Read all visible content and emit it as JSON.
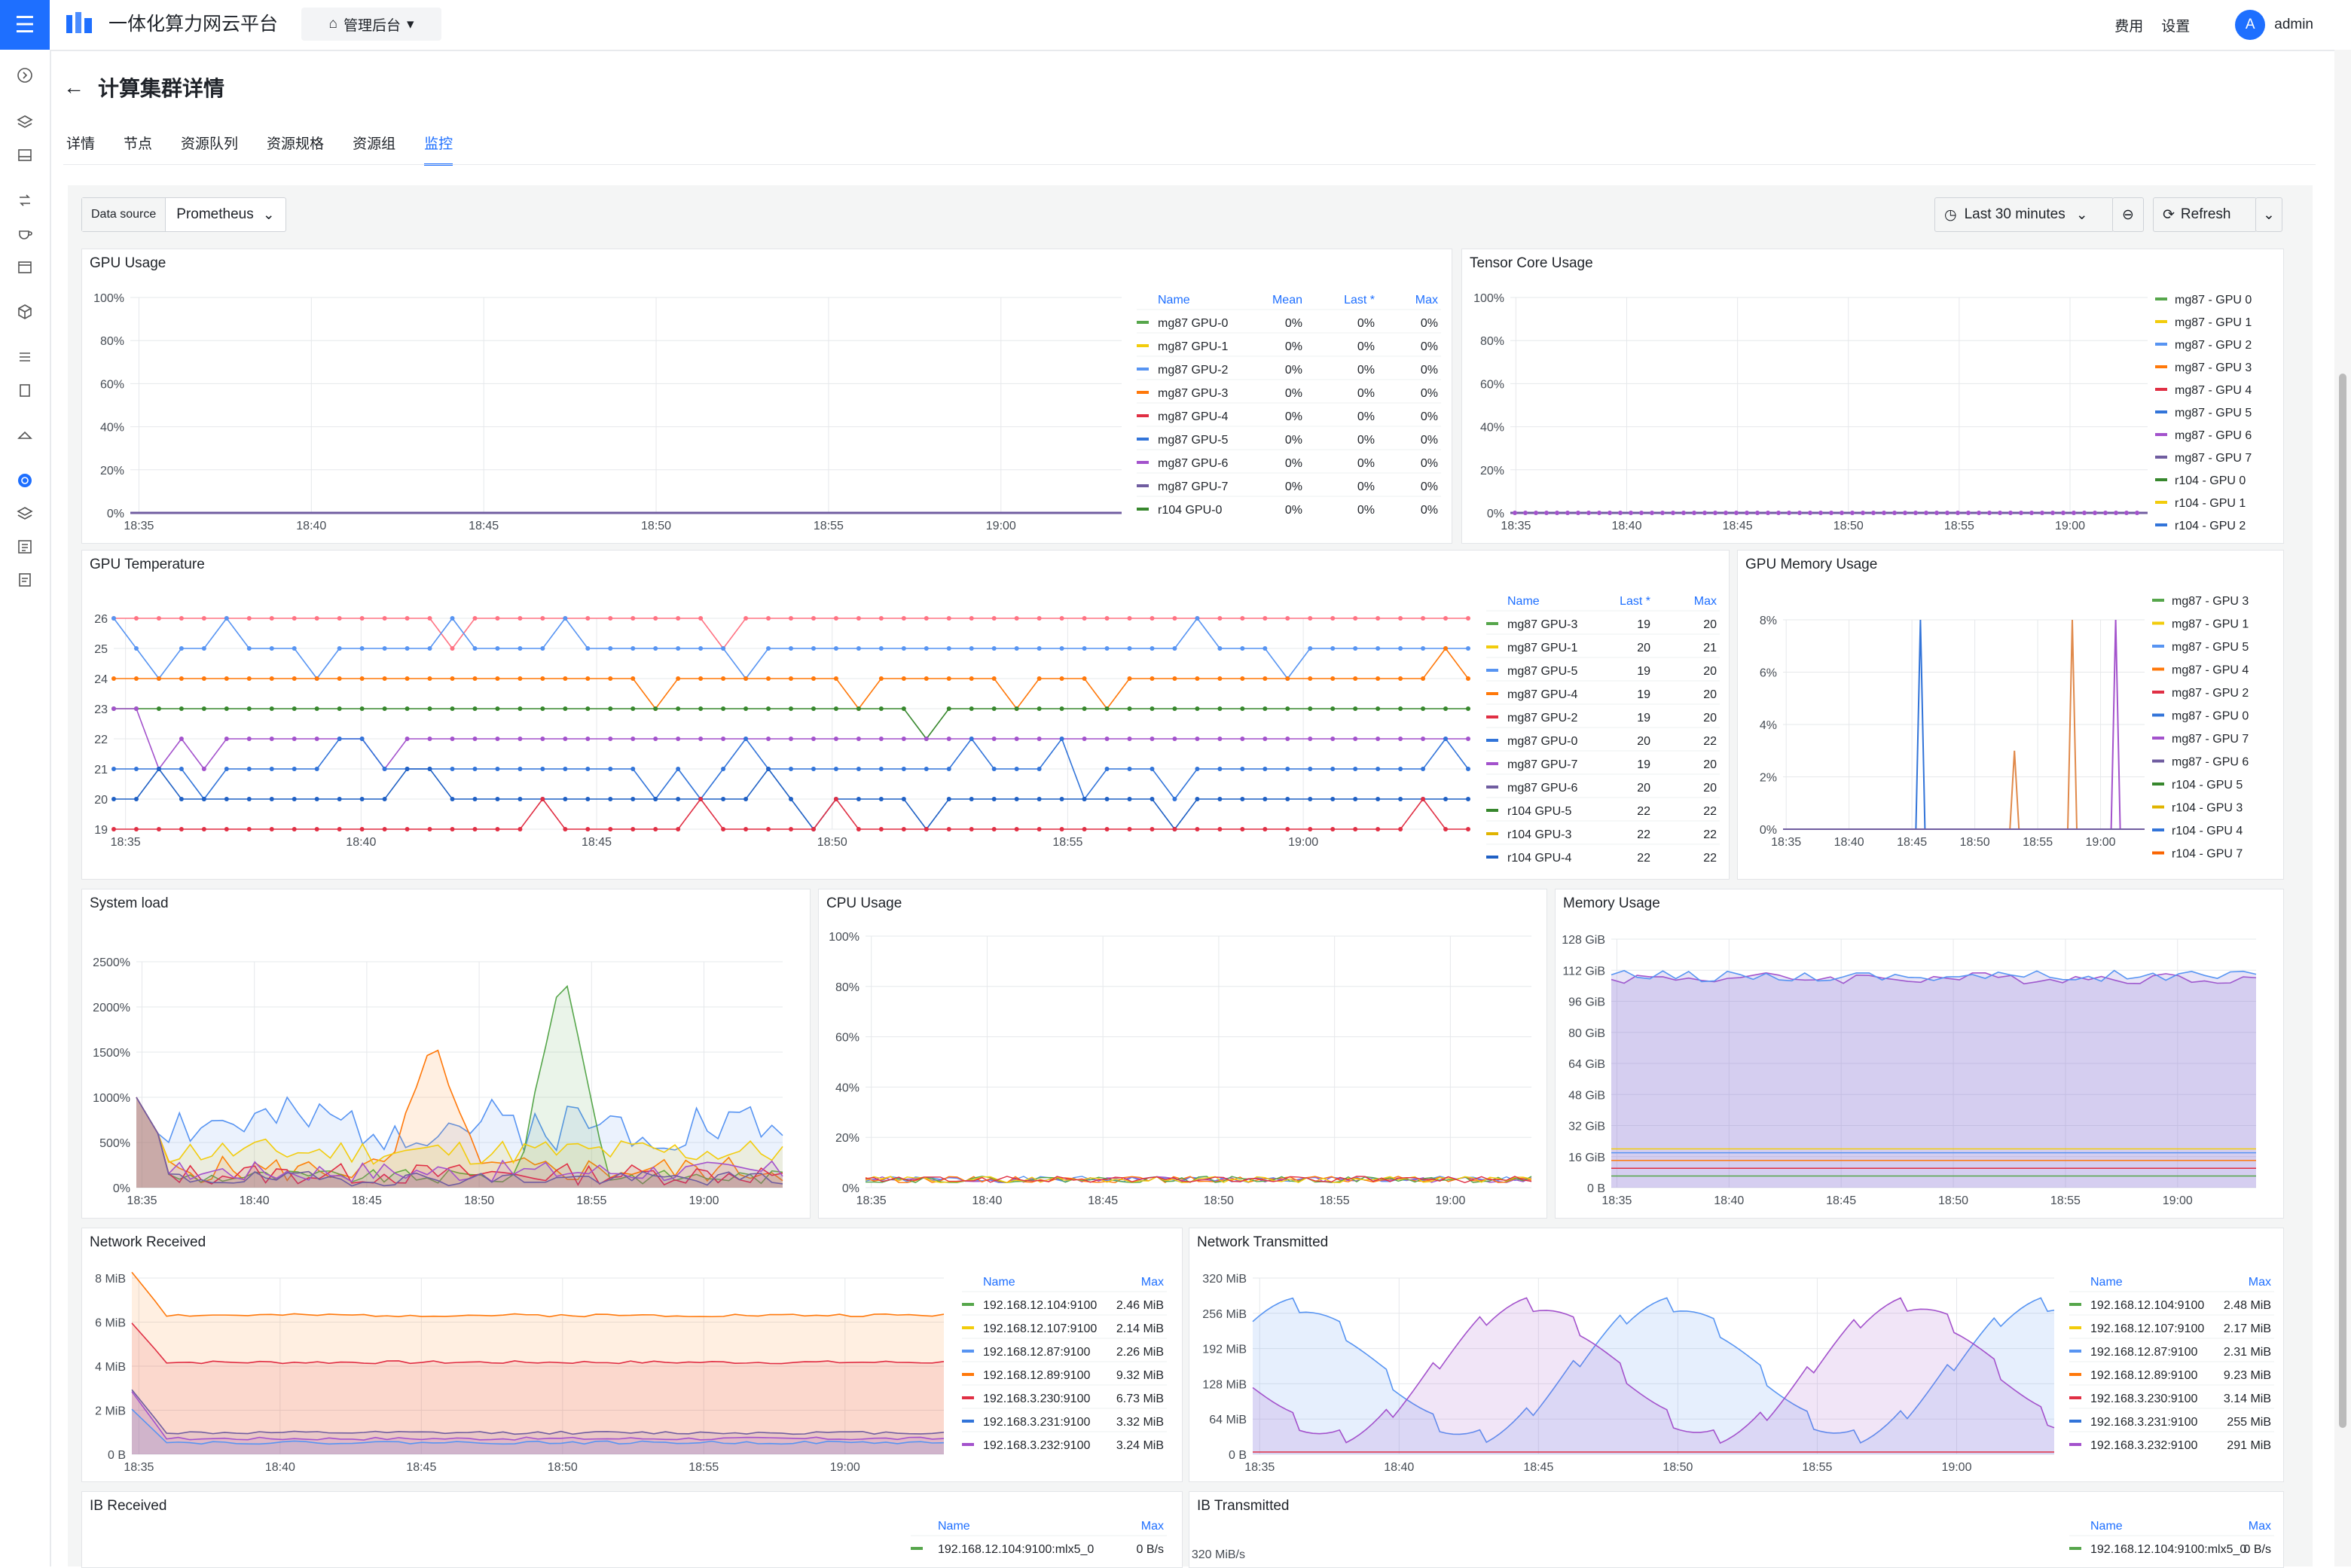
{
  "app_title": "一体化算力网云平台",
  "admin_menu": "管理后台",
  "header_links": [
    "费用",
    "设置"
  ],
  "user": {
    "initial": "A",
    "name": "admin"
  },
  "page_title": "计算集群详情",
  "tabs": [
    "详情",
    "节点",
    "资源队列",
    "资源规格",
    "资源组",
    "监控"
  ],
  "active_tab": "监控",
  "toolbar": {
    "ds_label": "Data source",
    "ds_value": "Prometheus",
    "time_range": "Last 30 minutes",
    "refresh": "Refresh"
  },
  "time_ticks": [
    "18:35",
    "18:40",
    "18:45",
    "18:50",
    "18:55",
    "19:00"
  ],
  "gpu_usage": {
    "title": "GPU Usage",
    "y_ticks": [
      "0%",
      "20%",
      "40%",
      "60%",
      "80%",
      "100%"
    ],
    "legend_headers": [
      "Name",
      "Mean",
      "Last *",
      "Max"
    ],
    "rows": [
      {
        "name": "mg87 GPU-0",
        "mean": "0%",
        "last": "0%",
        "max": "0%",
        "color": "#56a64b"
      },
      {
        "name": "mg87 GPU-1",
        "mean": "0%",
        "last": "0%",
        "max": "0%",
        "color": "#f2cc0c"
      },
      {
        "name": "mg87 GPU-2",
        "mean": "0%",
        "last": "0%",
        "max": "0%",
        "color": "#5794f2"
      },
      {
        "name": "mg87 GPU-3",
        "mean": "0%",
        "last": "0%",
        "max": "0%",
        "color": "#ff780a"
      },
      {
        "name": "mg87 GPU-4",
        "mean": "0%",
        "last": "0%",
        "max": "0%",
        "color": "#e02f44"
      },
      {
        "name": "mg87 GPU-5",
        "mean": "0%",
        "last": "0%",
        "max": "0%",
        "color": "#3274d9"
      },
      {
        "name": "mg87 GPU-6",
        "mean": "0%",
        "last": "0%",
        "max": "0%",
        "color": "#a352cc"
      },
      {
        "name": "mg87 GPU-7",
        "mean": "0%",
        "last": "0%",
        "max": "0%",
        "color": "#705da0"
      },
      {
        "name": "r104 GPU-0",
        "mean": "0%",
        "last": "0%",
        "max": "0%",
        "color": "#37872d"
      }
    ]
  },
  "tensor_core": {
    "title": "Tensor Core Usage",
    "y_ticks": [
      "0%",
      "20%",
      "40%",
      "60%",
      "80%",
      "100%"
    ],
    "legend": [
      {
        "name": "mg87 - GPU 0",
        "color": "#56a64b"
      },
      {
        "name": "mg87 - GPU 1",
        "color": "#f2cc0c"
      },
      {
        "name": "mg87 - GPU 2",
        "color": "#5794f2"
      },
      {
        "name": "mg87 - GPU 3",
        "color": "#ff780a"
      },
      {
        "name": "mg87 - GPU 4",
        "color": "#e02f44"
      },
      {
        "name": "mg87 - GPU 5",
        "color": "#3274d9"
      },
      {
        "name": "mg87 - GPU 6",
        "color": "#a352cc"
      },
      {
        "name": "mg87 - GPU 7",
        "color": "#705da0"
      },
      {
        "name": "r104 - GPU 0",
        "color": "#37872d"
      },
      {
        "name": "r104 - GPU 1",
        "color": "#f2cc0c"
      },
      {
        "name": "r104 - GPU 2",
        "color": "#3274d9"
      }
    ]
  },
  "gpu_temp": {
    "title": "GPU Temperature",
    "y_ticks": [
      "19",
      "20",
      "21",
      "22",
      "23",
      "24",
      "25",
      "26"
    ],
    "legend_headers": [
      "Name",
      "Last *",
      "Max"
    ],
    "rows": [
      {
        "name": "mg87 GPU-3",
        "last": "19",
        "max": "20",
        "color": "#56a64b"
      },
      {
        "name": "mg87 GPU-1",
        "last": "20",
        "max": "21",
        "color": "#f2cc0c"
      },
      {
        "name": "mg87 GPU-5",
        "last": "19",
        "max": "20",
        "color": "#5794f2"
      },
      {
        "name": "mg87 GPU-4",
        "last": "19",
        "max": "20",
        "color": "#ff780a"
      },
      {
        "name": "mg87 GPU-2",
        "last": "19",
        "max": "20",
        "color": "#e02f44"
      },
      {
        "name": "mg87 GPU-0",
        "last": "20",
        "max": "22",
        "color": "#3274d9"
      },
      {
        "name": "mg87 GPU-7",
        "last": "19",
        "max": "20",
        "color": "#a352cc"
      },
      {
        "name": "mg87 GPU-6",
        "last": "20",
        "max": "20",
        "color": "#705da0"
      },
      {
        "name": "r104 GPU-5",
        "last": "22",
        "max": "22",
        "color": "#37872d"
      },
      {
        "name": "r104 GPU-3",
        "last": "22",
        "max": "22",
        "color": "#e0b400"
      },
      {
        "name": "r104 GPU-4",
        "last": "22",
        "max": "22",
        "color": "#1f60c4"
      }
    ]
  },
  "gpu_mem": {
    "title": "GPU Memory Usage",
    "y_ticks": [
      "0%",
      "2%",
      "4%",
      "6%",
      "8%"
    ],
    "x_ticks": [
      "18:35",
      "18:40",
      "18:45",
      "18:50",
      "18:55",
      "19:00"
    ],
    "legend": [
      {
        "name": "mg87 - GPU 3",
        "color": "#56a64b"
      },
      {
        "name": "mg87 - GPU 1",
        "color": "#f2cc0c"
      },
      {
        "name": "mg87 - GPU 5",
        "color": "#5794f2"
      },
      {
        "name": "mg87 - GPU 4",
        "color": "#ff780a"
      },
      {
        "name": "mg87 - GPU 2",
        "color": "#e02f44"
      },
      {
        "name": "mg87 - GPU 0",
        "color": "#3274d9"
      },
      {
        "name": "mg87 - GPU 7",
        "color": "#a352cc"
      },
      {
        "name": "mg87 - GPU 6",
        "color": "#705da0"
      },
      {
        "name": "r104 - GPU 5",
        "color": "#37872d"
      },
      {
        "name": "r104 - GPU 3",
        "color": "#e0b400"
      },
      {
        "name": "r104 - GPU 4",
        "color": "#3274d9"
      },
      {
        "name": "r104 - GPU 7",
        "color": "#fa6400"
      }
    ]
  },
  "system_load": {
    "title": "System load",
    "y_ticks": [
      "0%",
      "500%",
      "1000%",
      "1500%",
      "2000%",
      "2500%"
    ]
  },
  "cpu_usage": {
    "title": "CPU Usage",
    "y_ticks": [
      "0%",
      "20%",
      "40%",
      "60%",
      "80%",
      "100%"
    ]
  },
  "memory_usage": {
    "title": "Memory Usage",
    "y_ticks": [
      "0 B",
      "16 GiB",
      "32 GiB",
      "48 GiB",
      "64 GiB",
      "80 GiB",
      "96 GiB",
      "112 GiB",
      "128 GiB"
    ]
  },
  "net_rx": {
    "title": "Network Received",
    "y_ticks": [
      "0 B",
      "2 MiB",
      "4 MiB",
      "6 MiB",
      "8 MiB"
    ],
    "legend_headers": [
      "Name",
      "Max"
    ],
    "rows": [
      {
        "name": "192.168.12.104:9100",
        "max": "2.46 MiB",
        "color": "#56a64b"
      },
      {
        "name": "192.168.12.107:9100",
        "max": "2.14 MiB",
        "color": "#f2cc0c"
      },
      {
        "name": "192.168.12.87:9100",
        "max": "2.26 MiB",
        "color": "#5794f2"
      },
      {
        "name": "192.168.12.89:9100",
        "max": "9.32 MiB",
        "color": "#ff780a"
      },
      {
        "name": "192.168.3.230:9100",
        "max": "6.73 MiB",
        "color": "#e02f44"
      },
      {
        "name": "192.168.3.231:9100",
        "max": "3.32 MiB",
        "color": "#3274d9"
      },
      {
        "name": "192.168.3.232:9100",
        "max": "3.24 MiB",
        "color": "#a352cc"
      }
    ]
  },
  "net_tx": {
    "title": "Network Transmitted",
    "y_ticks": [
      "0 B",
      "64 MiB",
      "128 MiB",
      "192 MiB",
      "256 MiB",
      "320 MiB"
    ],
    "legend_headers": [
      "Name",
      "Max"
    ],
    "rows": [
      {
        "name": "192.168.12.104:9100",
        "max": "2.48 MiB",
        "color": "#56a64b"
      },
      {
        "name": "192.168.12.107:9100",
        "max": "2.17 MiB",
        "color": "#f2cc0c"
      },
      {
        "name": "192.168.12.87:9100",
        "max": "2.31 MiB",
        "color": "#5794f2"
      },
      {
        "name": "192.168.12.89:9100",
        "max": "9.23 MiB",
        "color": "#ff780a"
      },
      {
        "name": "192.168.3.230:9100",
        "max": "3.14 MiB",
        "color": "#e02f44"
      },
      {
        "name": "192.168.3.231:9100",
        "max": "255 MiB",
        "color": "#3274d9"
      },
      {
        "name": "192.168.3.232:9100",
        "max": "291 MiB",
        "color": "#a352cc"
      }
    ]
  },
  "ib_rx": {
    "title": "IB Received",
    "legend_headers": [
      "Name",
      "Max"
    ],
    "rows": [
      {
        "name": "192.168.12.104:9100:mlx5_0",
        "max": "0 B/s",
        "color": "#56a64b"
      }
    ]
  },
  "ib_tx": {
    "title": "IB Transmitted",
    "y_top": "320 MiB/s",
    "legend_headers": [
      "Name",
      "Max"
    ],
    "rows": [
      {
        "name": "192.168.12.104:9100:mlx5_0",
        "max": "0 B/s",
        "color": "#56a64b"
      }
    ]
  },
  "chart_data": [
    {
      "type": "line",
      "title": "GPU Usage",
      "ylim": [
        0,
        100
      ],
      "series_values": "all 0%"
    },
    {
      "type": "line",
      "title": "Tensor Core Usage",
      "ylim": [
        0,
        100
      ],
      "series_values": "all 0%"
    },
    {
      "type": "line",
      "title": "GPU Temperature",
      "ylim": [
        19,
        26
      ]
    },
    {
      "type": "line",
      "title": "GPU Memory Usage",
      "ylim": [
        0,
        8
      ]
    },
    {
      "type": "area",
      "title": "System load",
      "ylim": [
        0,
        2500
      ]
    },
    {
      "type": "line",
      "title": "CPU Usage",
      "ylim": [
        0,
        100
      ]
    },
    {
      "type": "area",
      "title": "Memory Usage",
      "ylim": [
        0,
        128
      ]
    },
    {
      "type": "area",
      "title": "Network Received",
      "ylim": [
        0,
        9
      ]
    },
    {
      "type": "area",
      "title": "Network Transmitted",
      "ylim": [
        0,
        320
      ]
    }
  ]
}
